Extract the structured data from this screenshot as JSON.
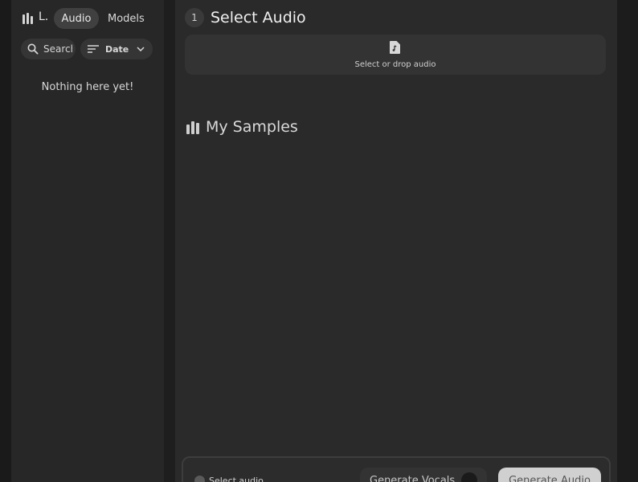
{
  "sidebar": {
    "library_label": "L.",
    "tabs": [
      {
        "label": "Audio",
        "active": true
      },
      {
        "label": "Models",
        "active": false
      }
    ],
    "search": {
      "placeholder": "Search"
    },
    "sort": {
      "label": "Date"
    },
    "empty_message": "Nothing here yet!"
  },
  "main": {
    "step_number": "1",
    "section_title": "Select Audio",
    "drop_zone": {
      "label": "Select or drop audio",
      "icon": "audio-file-icon"
    },
    "samples_title": "My Samples"
  },
  "bottom_bar": {
    "status_text": "Select audio",
    "vocals_toggle_label": "Generate Vocals",
    "generate_button_label": "Generate Audio"
  },
  "colors": {
    "background": "#1f1f1f",
    "panel": "#2a2a2a",
    "sidebar": "#272727",
    "accent_button": "#d0d0d0"
  }
}
